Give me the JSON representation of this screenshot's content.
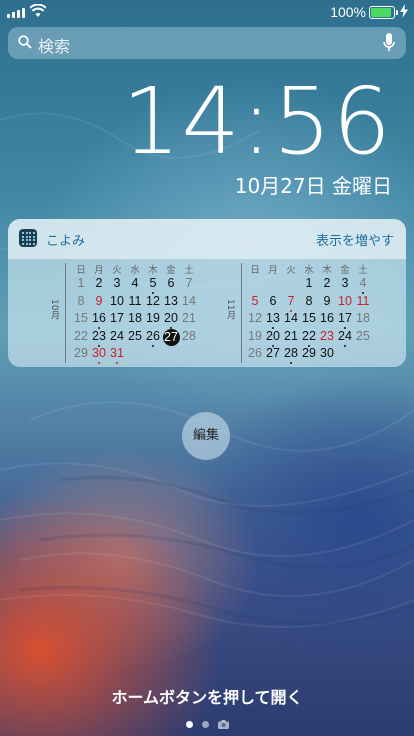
{
  "status": {
    "battery_pct": "100%",
    "icons": [
      "cellular-signal-icon",
      "wifi-icon",
      "battery-icon",
      "charging-bolt-icon"
    ],
    "battery_color": "#4cd964"
  },
  "search": {
    "placeholder": "検索",
    "icons": [
      "search-icon",
      "microphone-icon"
    ]
  },
  "lock": {
    "time": "14:56",
    "date": "10月27日 金曜日"
  },
  "widget": {
    "app_name": "こよみ",
    "show_more": "表示を増やす",
    "weekdays": [
      "日",
      "月",
      "火",
      "水",
      "木",
      "金",
      "土"
    ],
    "months": [
      {
        "label": "10月",
        "weeks": [
          [
            "1",
            "2",
            "3",
            "4",
            "5",
            "6",
            "7"
          ],
          [
            "8",
            "9",
            "10",
            "11",
            "12",
            "13",
            "14"
          ],
          [
            "15",
            "16",
            "17",
            "18",
            "19",
            "20",
            "21"
          ],
          [
            "22",
            "23",
            "24",
            "25",
            "26",
            "27",
            "28"
          ],
          [
            "29",
            "30",
            "31",
            "",
            "",
            "",
            ""
          ]
        ]
      },
      {
        "label": "11月",
        "weeks": [
          [
            "",
            "",
            "",
            "1",
            "2",
            "3",
            "4"
          ],
          [
            "5",
            "6",
            "7",
            "8",
            "9",
            "10",
            "11"
          ],
          [
            "12",
            "13",
            "14",
            "15",
            "16",
            "17",
            "18"
          ],
          [
            "19",
            "20",
            "21",
            "22",
            "23",
            "24",
            "25"
          ],
          [
            "26",
            "27",
            "28",
            "29",
            "30",
            "",
            ""
          ]
        ]
      }
    ],
    "colors": {
      "holiday_red": "#cc1f2b",
      "link_blue": "#1f6fa0"
    }
  },
  "edit_label": "編集",
  "unlock_hint": "ホームボタンを押して開く"
}
